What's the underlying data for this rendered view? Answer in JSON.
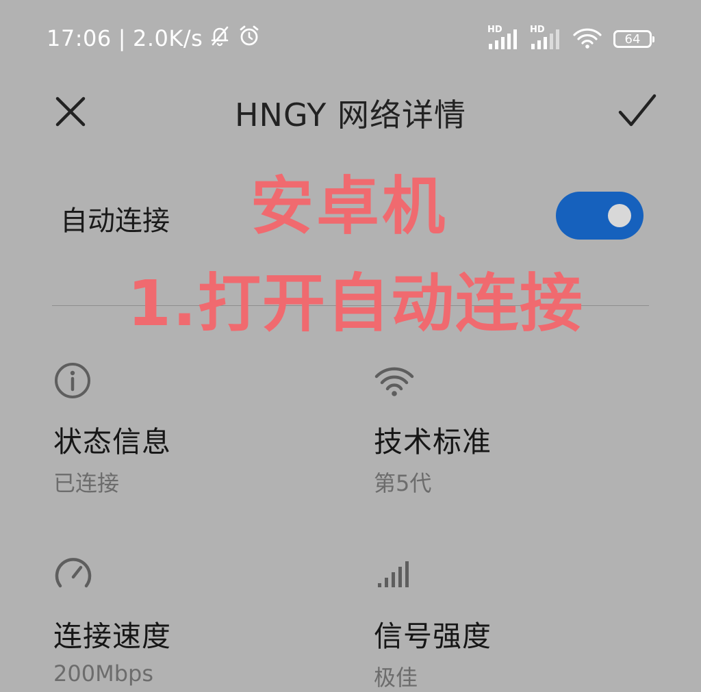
{
  "status_bar": {
    "time": "17:06",
    "separator": "|",
    "net_speed": "2.0K/s",
    "signal1_label": "HD",
    "signal2_label": "HD",
    "battery": "64",
    "text_color": "#ffffff"
  },
  "header": {
    "title": "HNGY 网络详情",
    "close_icon": "close-icon",
    "confirm_icon": "check-icon"
  },
  "auto_connect": {
    "label": "自动连接",
    "enabled": true,
    "toggle_color": "#1661bd"
  },
  "annotation": {
    "line1": "安卓机",
    "line2": "1.打开自动连接",
    "color": "#f06a6f"
  },
  "details": [
    {
      "icon": "info-icon",
      "label": "状态信息",
      "value": "已连接"
    },
    {
      "icon": "wifi-icon",
      "label": "技术标准",
      "value": "第5代"
    },
    {
      "icon": "speedometer-icon",
      "label": "连接速度",
      "value": "200Mbps"
    },
    {
      "icon": "signal-bars-icon",
      "label": "信号强度",
      "value": "极佳"
    }
  ]
}
